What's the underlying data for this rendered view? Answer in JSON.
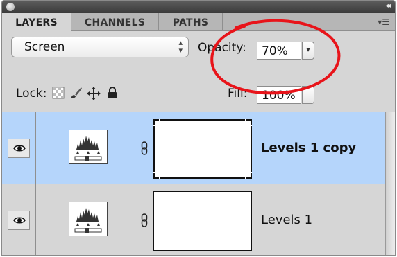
{
  "tabs": [
    {
      "label": "LAYERS",
      "active": true
    },
    {
      "label": "CHANNELS",
      "active": false
    },
    {
      "label": "PATHS",
      "active": false
    }
  ],
  "blend_mode": {
    "selected": "Screen"
  },
  "opacity": {
    "label": "Opacity:",
    "value": "70%"
  },
  "lock": {
    "label": "Lock:",
    "icons": [
      "lock-transparent-pixels-icon",
      "lock-image-pixels-icon",
      "lock-position-icon",
      "lock-all-icon"
    ]
  },
  "fill": {
    "label": "Fill:",
    "value": "100%"
  },
  "layers": [
    {
      "name": "Levels 1 copy",
      "selected": true,
      "visible": true
    },
    {
      "name": "Levels 1",
      "selected": false,
      "visible": true
    }
  ],
  "colors": {
    "selection": "#b5d5fb",
    "annotation": "#e8141a",
    "panel": "#d6d6d6"
  }
}
